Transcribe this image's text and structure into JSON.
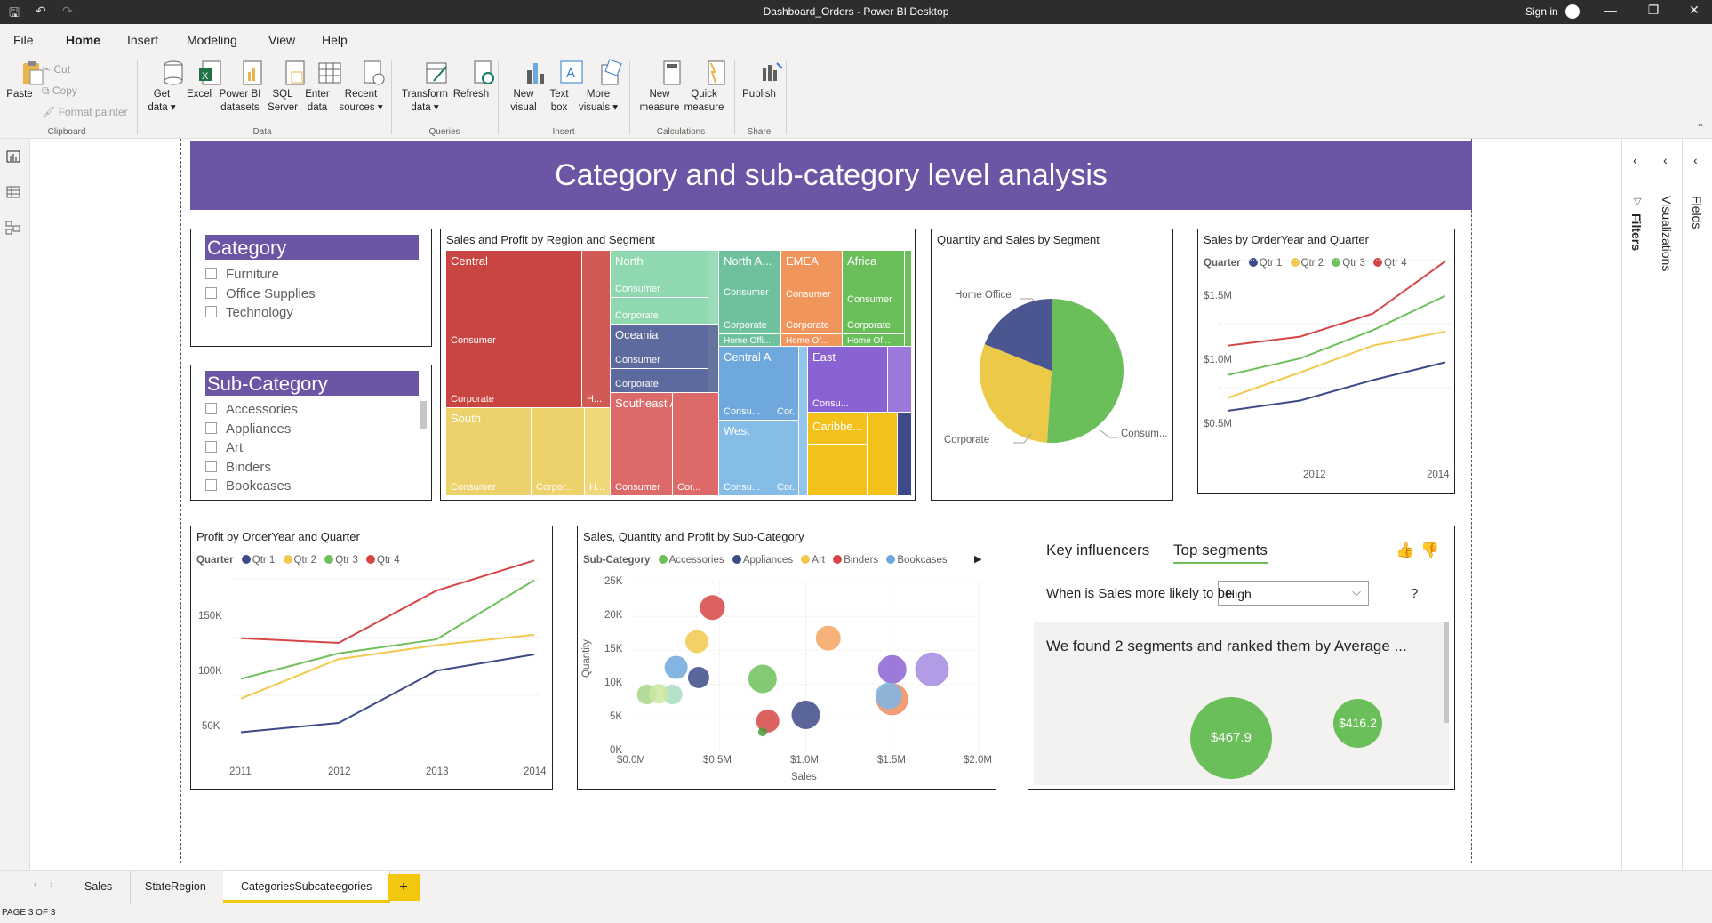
{
  "window": {
    "title": "Dashboard_Orders - Power BI Desktop",
    "sign_in": "Sign in"
  },
  "menu": {
    "tabs": [
      "File",
      "Home",
      "Insert",
      "Modeling",
      "View",
      "Help"
    ],
    "active": "Home"
  },
  "ribbon": {
    "clipboard": {
      "paste": "Paste",
      "cut": "Cut",
      "copy": "Copy",
      "format_painter": "Format painter",
      "group": "Clipboard"
    },
    "data": {
      "get_data": "Get data",
      "excel": "Excel",
      "pbi_datasets": "Power BI datasets",
      "sql_server": "SQL Server",
      "enter_data": "Enter data",
      "recent_sources": "Recent sources",
      "group": "Data"
    },
    "queries": {
      "transform": "Transform data",
      "refresh": "Refresh",
      "group": "Queries"
    },
    "insert": {
      "new_visual": "New visual",
      "text_box": "Text box",
      "more_visuals": "More visuals",
      "group": "Insert"
    },
    "calculations": {
      "new_measure": "New measure",
      "quick_measure": "Quick measure",
      "group": "Calculations"
    },
    "share": {
      "publish": "Publish",
      "group": "Share"
    }
  },
  "banner": "Category and sub-category level analysis",
  "category_slicer": {
    "header": "Category",
    "items": [
      "Furniture",
      "Office Supplies",
      "Technology"
    ]
  },
  "subcategory_slicer": {
    "header": "Sub-Category",
    "items": [
      "Accessories",
      "Appliances",
      "Art",
      "Binders",
      "Bookcases"
    ]
  },
  "treemap": {
    "title": "Sales and Profit by Region and Segment",
    "labels": {
      "central": "Central",
      "north": "North",
      "north_asia": "North A...",
      "emea": "EMEA",
      "africa": "Africa",
      "oceania": "Oceania",
      "central_asia": "Central Asia",
      "east": "East",
      "south": "South",
      "southeast_asia": "Southeast Asia",
      "west": "West",
      "caribbean": "Caribbe..."
    },
    "seg": {
      "consumer": "Consumer",
      "corporate": "Corporate",
      "home_office_short": "H...",
      "corporate_short": "Corpor...",
      "consumer_short": "Consu...",
      "cor_short": "Cor...",
      "home_offi": "Home Offi...",
      "home_of": "Home Of..."
    }
  },
  "pie": {
    "title": "Quantity and Sales by Segment",
    "labels": [
      "Home Office",
      "Corporate",
      "Consum..."
    ]
  },
  "sales_line": {
    "title": "Sales by OrderYear and Quarter",
    "legend_title": "Quarter",
    "legend": [
      "Qtr 1",
      "Qtr 2",
      "Qtr 3",
      "Qtr 4"
    ],
    "yticks": [
      "$1.5M",
      "$1.0M",
      "$0.5M"
    ],
    "xticks": [
      "2012",
      "2014"
    ]
  },
  "profit_line": {
    "title": "Profit by OrderYear and Quarter",
    "legend_title": "Quarter",
    "legend": [
      "Qtr 1",
      "Qtr 2",
      "Qtr 3",
      "Qtr 4"
    ],
    "yticks": [
      "150K",
      "100K",
      "50K"
    ],
    "xticks": [
      "2011",
      "2012",
      "2013",
      "2014"
    ]
  },
  "scatter": {
    "title": "Sales, Quantity and Profit by Sub-Category",
    "legend_title": "Sub-Category",
    "legend": [
      "Accessories",
      "Appliances",
      "Art",
      "Binders",
      "Bookcases"
    ],
    "yticks": [
      "25K",
      "20K",
      "15K",
      "10K",
      "5K",
      "0K"
    ],
    "xticks": [
      "$0.0M",
      "$0.5M",
      "$1.0M",
      "$1.5M",
      "$2.0M"
    ],
    "xlabel": "Sales",
    "ylabel": "Quantity"
  },
  "key_influencers": {
    "tab1": "Key influencers",
    "tab2": "Top segments",
    "question": "When is Sales more likely to be",
    "value": "High",
    "help": "?",
    "found": "We found 2 segments and ranked them by Average ...",
    "bubble1": "$467.9",
    "bubble2": "$416.2"
  },
  "pages": {
    "tabs": [
      "Sales",
      "StateRegion",
      "CategoriesSubcateegories"
    ],
    "add": "+",
    "status": "PAGE 3 OF 3"
  },
  "panes": {
    "filters": "Filters",
    "visualizations": "Visualizations",
    "fields": "Fields"
  },
  "colors": {
    "purple": "#6b55a4",
    "q1": "#3d4a88",
    "q2": "#f2c94c",
    "q3": "#6fbf5b",
    "q4": "#d64545"
  },
  "chart_data": [
    {
      "type": "line",
      "title": "Sales by OrderYear and Quarter",
      "x": [
        "2011",
        "2012",
        "2013",
        "2014"
      ],
      "ylabel": "",
      "ylim": [
        0,
        1600000
      ],
      "series": [
        {
          "name": "Qtr 1",
          "values": [
            320000,
            400000,
            560000,
            700000
          ]
        },
        {
          "name": "Qtr 2",
          "values": [
            420000,
            620000,
            830000,
            940000
          ]
        },
        {
          "name": "Qtr 3",
          "values": [
            600000,
            730000,
            950000,
            1220000
          ]
        },
        {
          "name": "Qtr 4",
          "values": [
            830000,
            900000,
            1080000,
            1490000
          ]
        }
      ]
    },
    {
      "type": "line",
      "title": "Profit by OrderYear and Quarter",
      "x": [
        "2011",
        "2012",
        "2013",
        "2014"
      ],
      "ylabel": "",
      "ylim": [
        0,
        180000
      ],
      "series": [
        {
          "name": "Qtr 1",
          "values": [
            18000,
            26000,
            71000,
            85000
          ]
        },
        {
          "name": "Qtr 2",
          "values": [
            47000,
            81000,
            93000,
            102000
          ]
        },
        {
          "name": "Qtr 3",
          "values": [
            64000,
            86000,
            98000,
            149000
          ]
        },
        {
          "name": "Qtr 4",
          "values": [
            99000,
            95000,
            140000,
            166000
          ]
        }
      ]
    },
    {
      "type": "pie",
      "title": "Quantity and Sales by Segment",
      "categories": [
        "Consumer",
        "Corporate",
        "Home Office"
      ],
      "values": [
        51,
        30,
        19
      ]
    },
    {
      "type": "scatter",
      "title": "Sales, Quantity and Profit by Sub-Category",
      "xlabel": "Sales",
      "ylabel": "Quantity",
      "xlim": [
        0,
        2000000
      ],
      "ylim": [
        0,
        25000
      ],
      "points": [
        {
          "x": 460000,
          "y": 21300,
          "r": 14,
          "c": "#d64545"
        },
        {
          "x": 1130000,
          "y": 16800,
          "r": 14,
          "c": "#f4a460"
        },
        {
          "x": 370000,
          "y": 16300,
          "r": 13,
          "c": "#f2c94c"
        },
        {
          "x": 250000,
          "y": 12500,
          "r": 13,
          "c": "#6fa8dc"
        },
        {
          "x": 380000,
          "y": 11000,
          "r": 12,
          "c": "#3d4a88"
        },
        {
          "x": 750000,
          "y": 10800,
          "r": 16,
          "c": "#6fbf5b"
        },
        {
          "x": 1500000,
          "y": 12200,
          "r": 16,
          "c": "#8a63d2"
        },
        {
          "x": 1730000,
          "y": 12200,
          "r": 19,
          "c": "#a58be0"
        },
        {
          "x": 80000,
          "y": 8500,
          "r": 11,
          "c": "#a8d58a"
        },
        {
          "x": 230000,
          "y": 8500,
          "r": 11,
          "c": "#a8dcc0"
        },
        {
          "x": 150000,
          "y": 8600,
          "r": 11,
          "c": "#cbe7a0"
        },
        {
          "x": 1000000,
          "y": 5500,
          "r": 16,
          "c": "#3d4a88"
        },
        {
          "x": 780000,
          "y": 4600,
          "r": 13,
          "c": "#d64545"
        },
        {
          "x": 750000,
          "y": 3000,
          "r": 5,
          "c": "#4e9a3a"
        },
        {
          "x": 1500000,
          "y": 7800,
          "r": 18,
          "c": "#f28c5c"
        },
        {
          "x": 1480000,
          "y": 8300,
          "r": 15,
          "c": "#7ab6e6"
        }
      ]
    }
  ]
}
